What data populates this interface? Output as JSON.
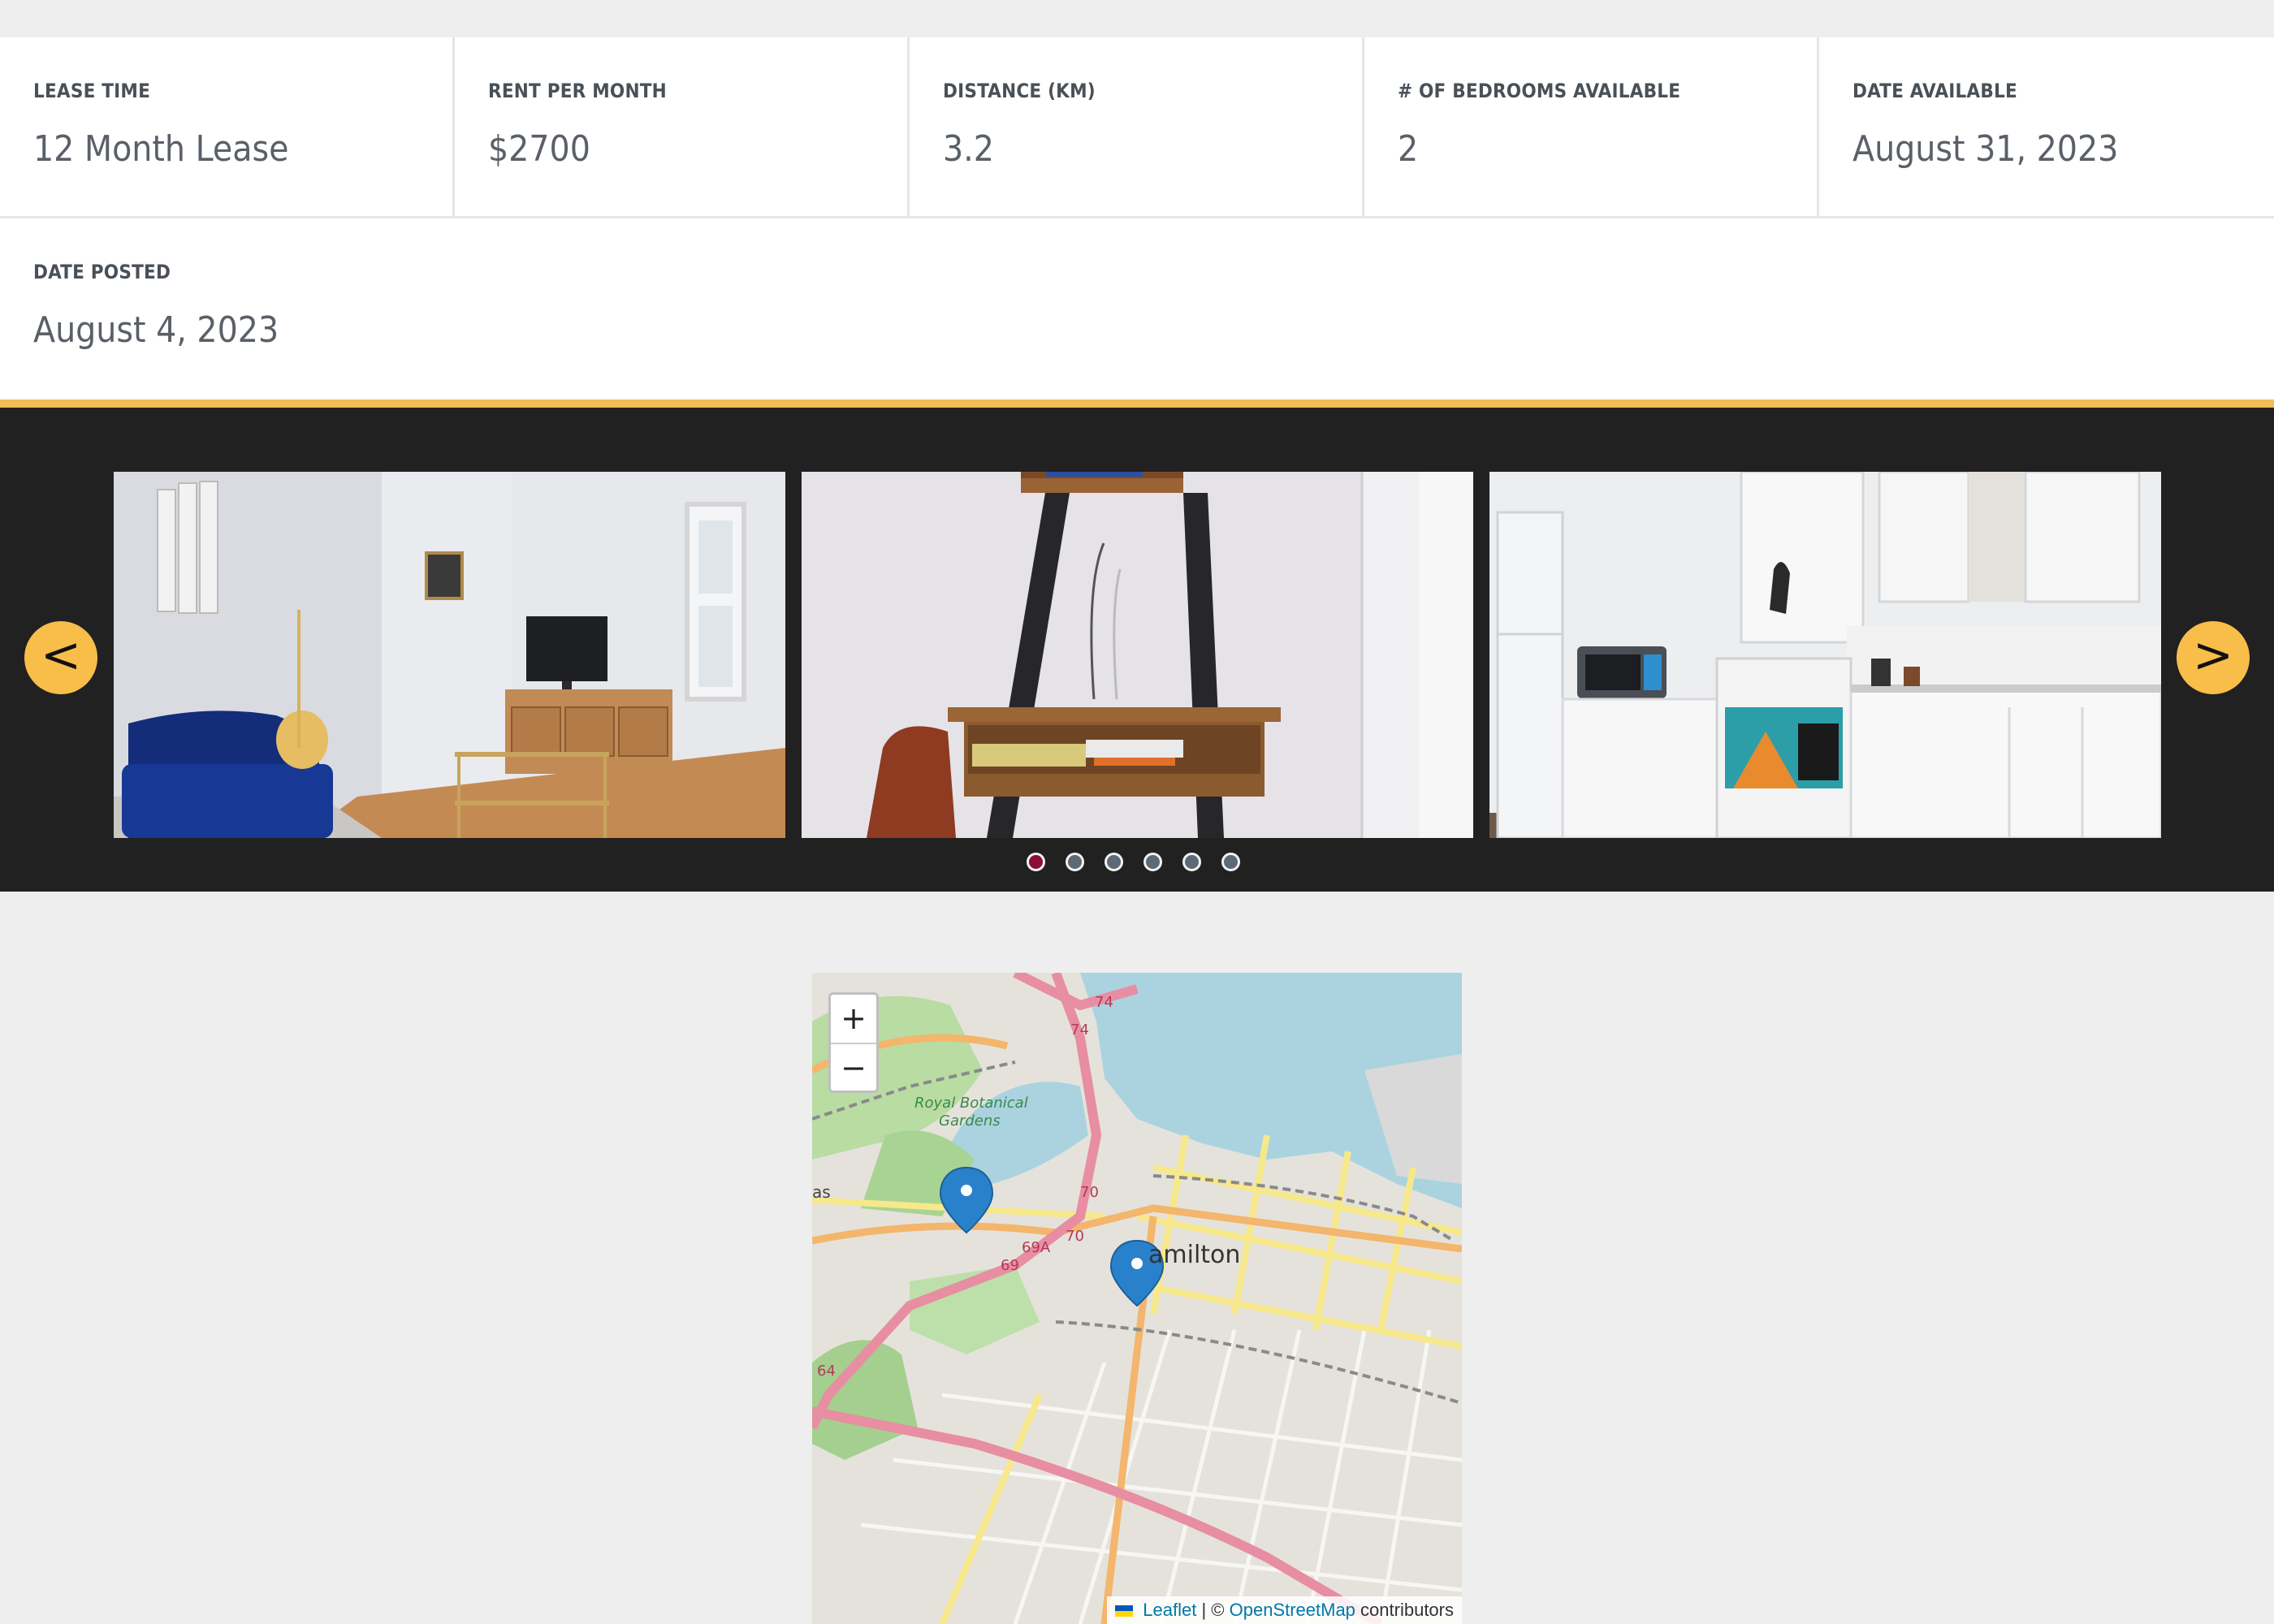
{
  "details": {
    "lease_time": {
      "label": "LEASE TIME",
      "value": "12 Month Lease"
    },
    "rent": {
      "label": "RENT PER MONTH",
      "value": "$2700"
    },
    "distance": {
      "label": "DISTANCE (KM)",
      "value": "3.2"
    },
    "bedrooms": {
      "label": "# OF BEDROOMS AVAILABLE",
      "value": "2"
    },
    "date_available": {
      "label": "DATE AVAILABLE",
      "value": "August 31, 2023"
    },
    "date_posted": {
      "label": "DATE POSTED",
      "value": "August 4, 2023"
    }
  },
  "colors": {
    "accent": "#f2bd55",
    "carousel_bg": "#212121",
    "nav_button": "#f9bd4a",
    "active_dot": "#8a0e3c"
  },
  "carousel": {
    "prev_label": "<",
    "next_label": ">",
    "slides": [
      "living-room-photo",
      "desk-photo",
      "kitchen-photo"
    ],
    "dot_count": 6,
    "active_index": 0
  },
  "map": {
    "zoom_in_label": "+",
    "zoom_out_label": "−",
    "city_label": "amilton",
    "park_label_1": "Royal Botanical",
    "park_label_2": "Gardens",
    "edge_label": "as",
    "road_labels": [
      "74",
      "74",
      "70",
      "70",
      "69A",
      "69",
      "64"
    ],
    "attribution": {
      "leaflet": "Leaflet",
      "separator": "| ©",
      "osm": "OpenStreetMap",
      "suffix": "contributors"
    },
    "marker_count": 2
  }
}
